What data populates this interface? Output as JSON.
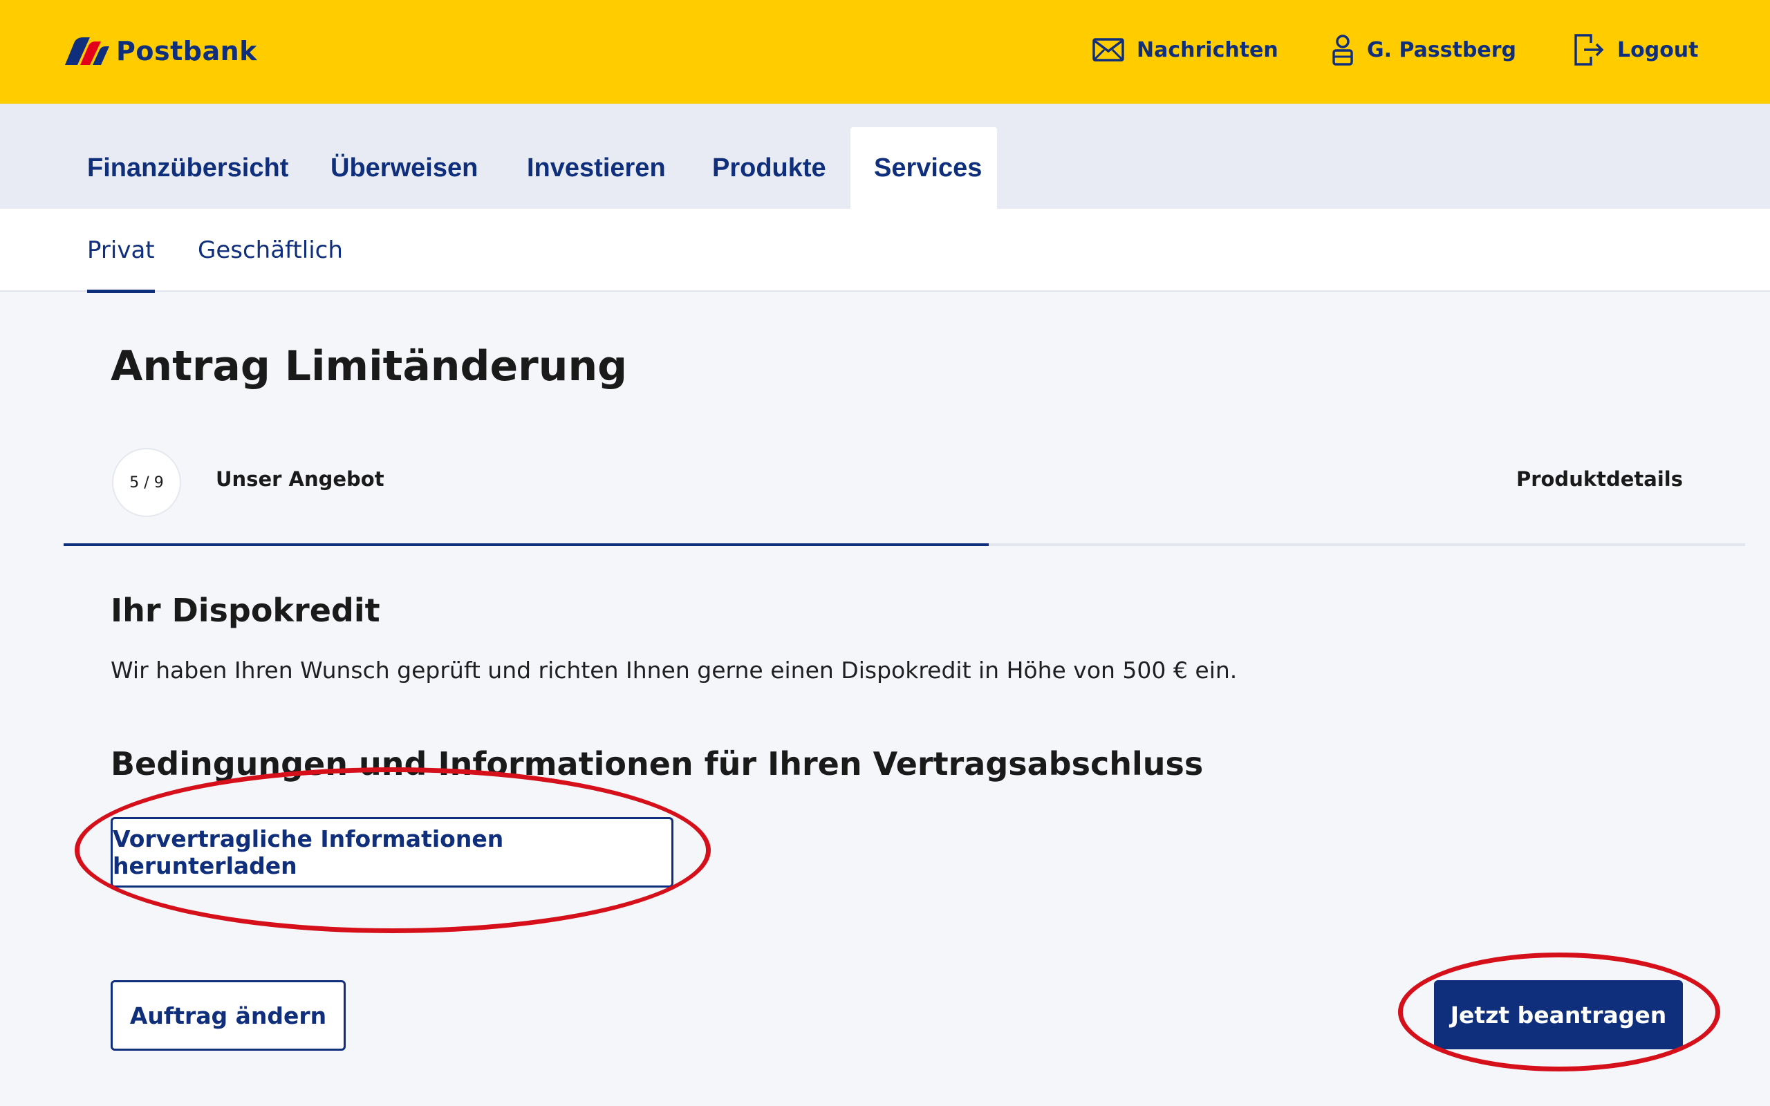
{
  "header": {
    "brand": "Postbank",
    "links": {
      "messages": "Nachrichten",
      "user": "G. Passtberg",
      "logout": "Logout"
    },
    "icons": [
      "mail-icon",
      "user-icon",
      "logout-icon"
    ]
  },
  "main_nav": {
    "items": [
      {
        "label": "Finanzübersicht"
      },
      {
        "label": "Überweisen"
      },
      {
        "label": "Investieren"
      },
      {
        "label": "Produkte"
      },
      {
        "label": "Services",
        "active": true
      }
    ]
  },
  "sub_nav": {
    "items": [
      {
        "label": "Privat",
        "active": true
      },
      {
        "label": "Geschäftlich"
      }
    ]
  },
  "page": {
    "title": "Antrag Limitänderung",
    "stepper": {
      "counter": "5 / 9",
      "current_step": "Unser Angebot",
      "next_step": "Produktdetails",
      "progress": 0.55
    },
    "dispo": {
      "heading": "Ihr Dispokredit",
      "text": "Wir haben Ihren Wunsch geprüft und richten Ihnen gerne einen Dispokredit in Höhe von 500 € ein."
    },
    "conditions": {
      "heading": "Bedingungen und Informationen für Ihren Vertragsabschluss",
      "download_button": "Vorvertragliche Informationen herunterladen"
    },
    "actions": {
      "change_button": "Auftrag ändern",
      "apply_button": "Jetzt beantragen"
    }
  },
  "colors": {
    "header_bg": "#ffcc00",
    "brand_blue": "#0f2e7b",
    "nav_bg": "#e8ebf3",
    "annotation_red": "#d6101b"
  }
}
